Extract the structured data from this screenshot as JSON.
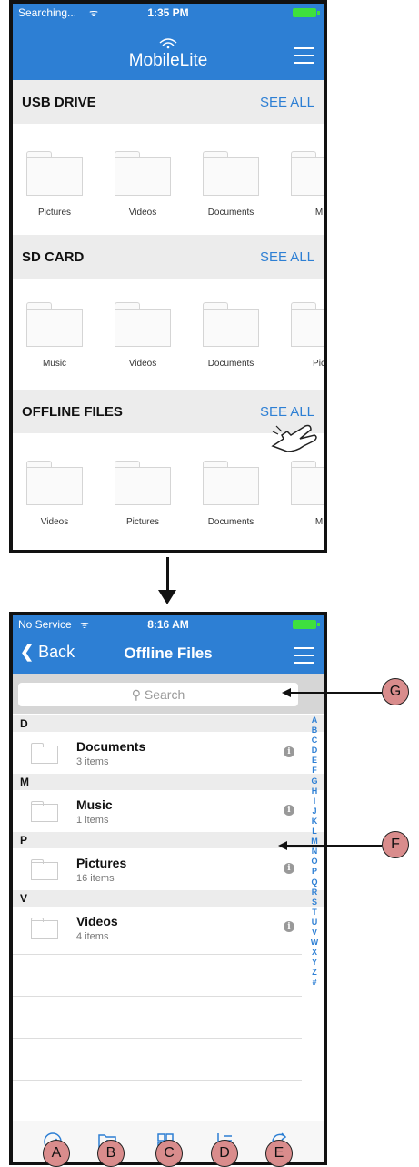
{
  "screen1": {
    "status": {
      "carrier": "Searching...",
      "time": "1:35 PM"
    },
    "header": {
      "logo": "MobileLite"
    },
    "sections": [
      {
        "title": "USB DRIVE",
        "see_all": "SEE ALL",
        "folders": [
          "Pictures",
          "Videos",
          "Documents",
          "M"
        ]
      },
      {
        "title": "SD CARD",
        "see_all": "SEE ALL",
        "folders": [
          "Music",
          "Videos",
          "Documents",
          "Pic"
        ]
      },
      {
        "title": "OFFLINE FILES",
        "see_all": "SEE ALL",
        "folders": [
          "Videos",
          "Pictures",
          "Documents",
          "M"
        ]
      }
    ]
  },
  "screen2": {
    "status": {
      "carrier": "No Service",
      "time": "8:16 AM"
    },
    "nav": {
      "back": "Back",
      "title": "Offline Files"
    },
    "search": {
      "placeholder": "Search"
    },
    "groups": [
      {
        "letter": "D",
        "name": "Documents",
        "count": "3 items"
      },
      {
        "letter": "M",
        "name": "Music",
        "count": "1 items"
      },
      {
        "letter": "P",
        "name": "Pictures",
        "count": "16 items"
      },
      {
        "letter": "V",
        "name": "Videos",
        "count": "4 items"
      }
    ],
    "index_letters": [
      "A",
      "B",
      "C",
      "D",
      "E",
      "F",
      "G",
      "H",
      "I",
      "J",
      "K",
      "L",
      "M",
      "N",
      "O",
      "P",
      "Q",
      "R",
      "S",
      "T",
      "U",
      "V",
      "W",
      "X",
      "Y",
      "Z",
      "#"
    ],
    "toolbar_icons": [
      "select-check-icon",
      "new-folder-icon",
      "grid-view-icon",
      "sort-icon",
      "refresh-icon"
    ]
  },
  "callouts": {
    "A": "A",
    "B": "B",
    "C": "C",
    "D": "D",
    "E": "E",
    "F": "F",
    "G": "G"
  },
  "colors": {
    "accent": "#2d7fd4",
    "callout": "#d98c8c"
  }
}
